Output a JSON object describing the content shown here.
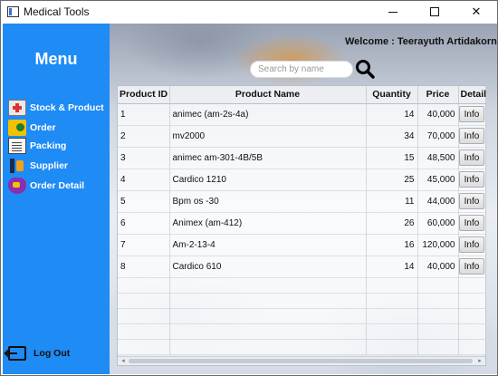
{
  "window": {
    "title": "Medical Tools",
    "controls": {
      "minimize": "minimize",
      "maximize": "maximize",
      "close": "✕"
    }
  },
  "sidebar": {
    "menu_title": "Menu",
    "items": [
      {
        "label": "Stock & Product",
        "icon": "first-aid-kit-icon"
      },
      {
        "label": "Order",
        "icon": "folder-order-icon"
      },
      {
        "label": "Packing",
        "icon": "clipboard-icon"
      },
      {
        "label": "Supplier",
        "icon": "supplier-icon"
      },
      {
        "label": "Order Detail",
        "icon": "basket-icon"
      }
    ],
    "logout_label": "Log Out"
  },
  "header": {
    "welcome": "Welcome : Teerayuth Artidakorn"
  },
  "search": {
    "placeholder": "Search by name",
    "value": ""
  },
  "table": {
    "columns": [
      "Product ID",
      "Product Name",
      "Quantity",
      "Price",
      "Detail"
    ],
    "rows": [
      {
        "id": "1",
        "name": "animec (am-2s-4a)",
        "quantity": "14",
        "price": "40,000",
        "detail": "Info"
      },
      {
        "id": "2",
        "name": "mv2000",
        "quantity": "34",
        "price": "70,000",
        "detail": "Info"
      },
      {
        "id": "3",
        "name": "animec am-301-4B/5B",
        "quantity": "15",
        "price": "48,500",
        "detail": "Info"
      },
      {
        "id": "4",
        "name": "Cardico 1210",
        "quantity": "25",
        "price": "45,000",
        "detail": "Info"
      },
      {
        "id": "5",
        "name": "Bpm os -30",
        "quantity": "11",
        "price": "44,000",
        "detail": "Info"
      },
      {
        "id": "6",
        "name": "Animex (am-412)",
        "quantity": "26",
        "price": "60,000",
        "detail": "Info"
      },
      {
        "id": "7",
        "name": "Am-2-13-4",
        "quantity": "16",
        "price": "120,000",
        "detail": "Info"
      },
      {
        "id": "8",
        "name": "Cardico 610",
        "quantity": "14",
        "price": "40,000",
        "detail": "Info"
      }
    ]
  },
  "colors": {
    "sidebar": "#1f8bf5",
    "text_on_sidebar": "#ffffff"
  }
}
